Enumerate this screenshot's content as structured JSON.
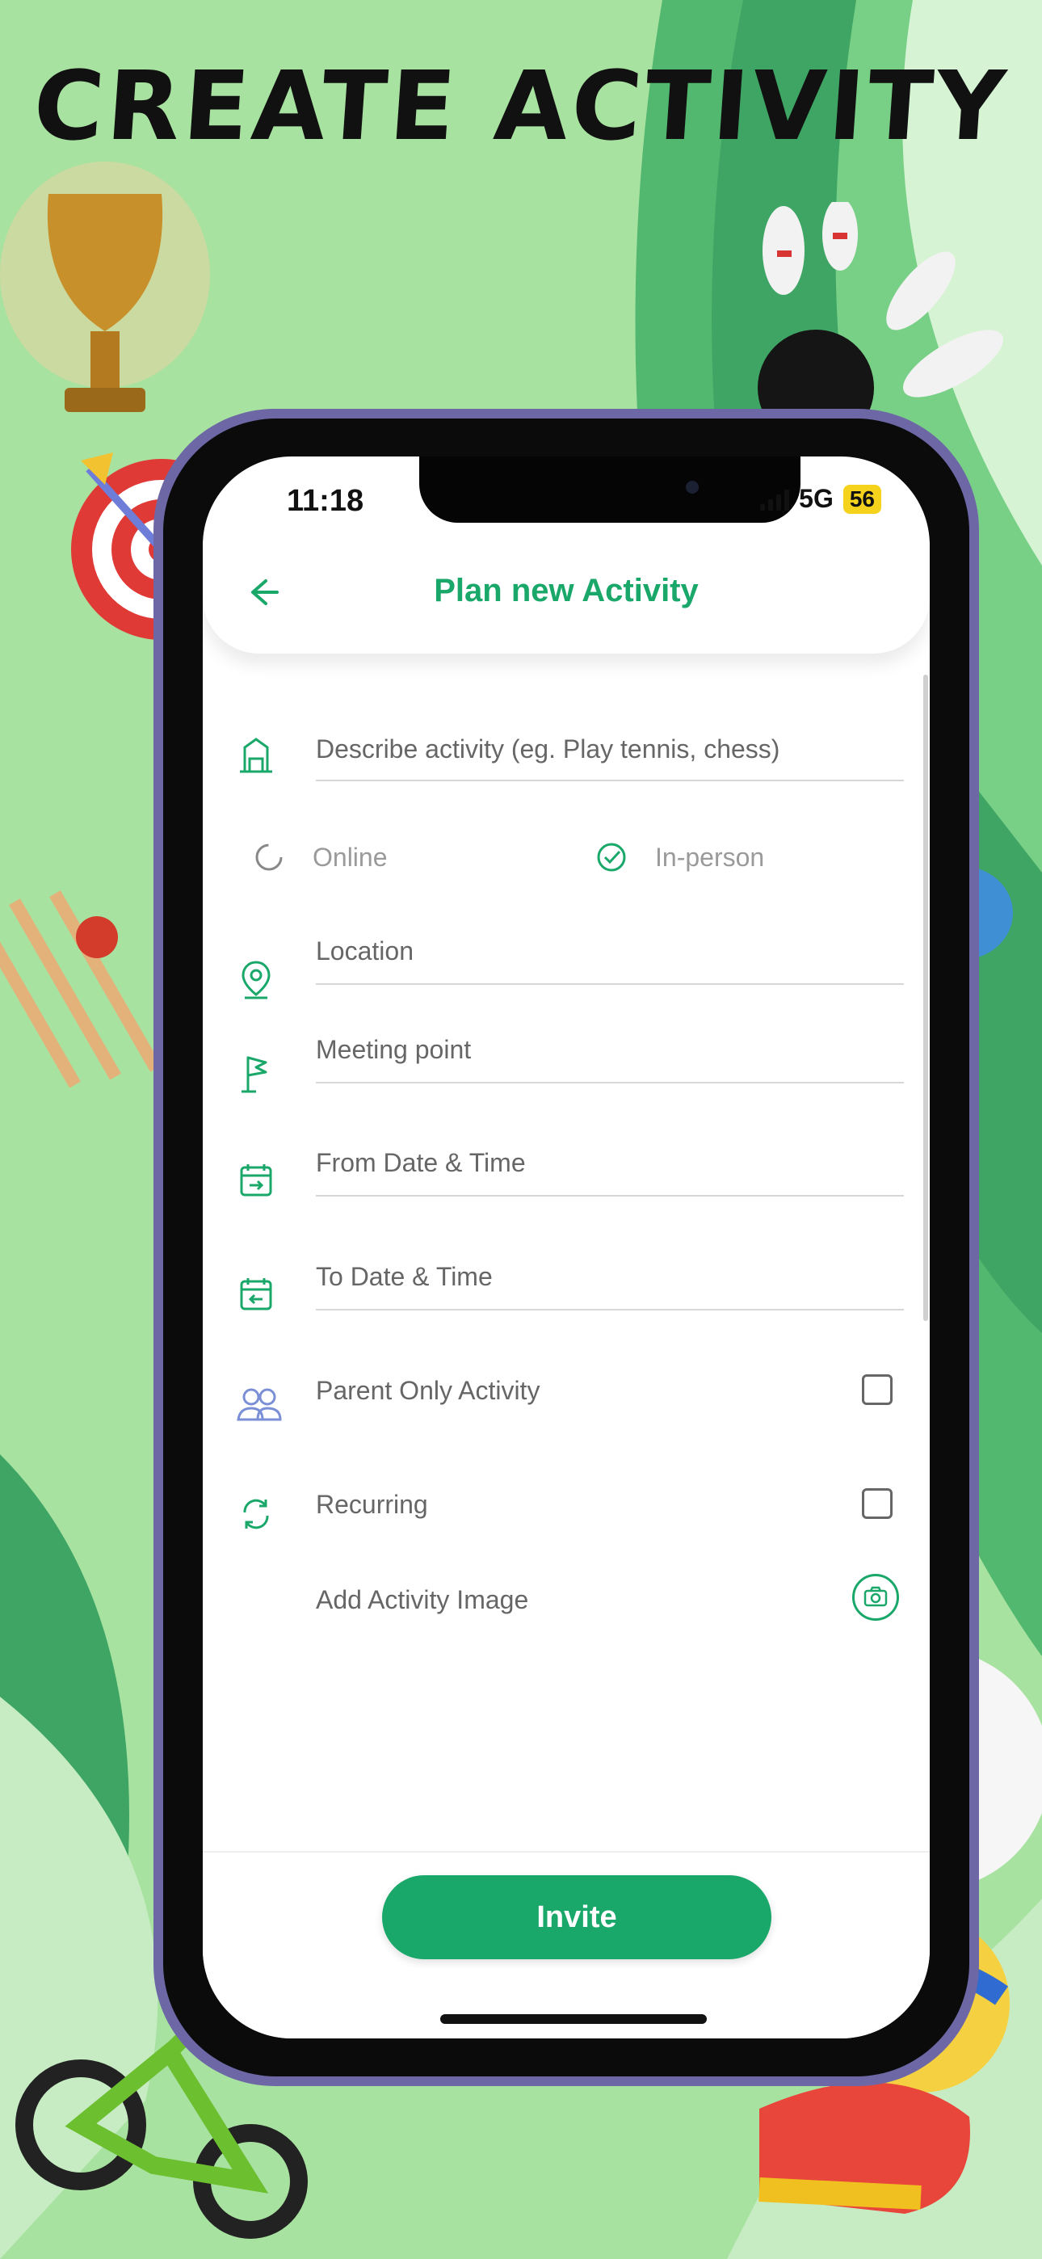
{
  "marketing": {
    "headline": "CREATE ACTIVITY"
  },
  "status_bar": {
    "time": "11:18",
    "network": "5G",
    "battery": "56"
  },
  "app_bar": {
    "title": "Plan new Activity",
    "back_icon": "arrow-left-icon"
  },
  "form": {
    "describe_placeholder": "Describe activity (eg. Play tennis, chess)",
    "mode_options": [
      {
        "label": "Online",
        "selected": false
      },
      {
        "label": "In-person",
        "selected": true
      }
    ],
    "location_placeholder": "Location",
    "meeting_point_placeholder": "Meeting point",
    "from_datetime_placeholder": "From Date & Time",
    "to_datetime_placeholder": "To Date & Time",
    "parent_only_label": "Parent Only Activity",
    "parent_only_checked": false,
    "recurring_label": "Recurring",
    "recurring_checked": false,
    "add_image_label": "Add Activity Image"
  },
  "actions": {
    "invite_label": "Invite"
  },
  "colors": {
    "accent": "#1aa86a",
    "background": "#a8e2a0",
    "phone_frame": "#6d67a6"
  }
}
